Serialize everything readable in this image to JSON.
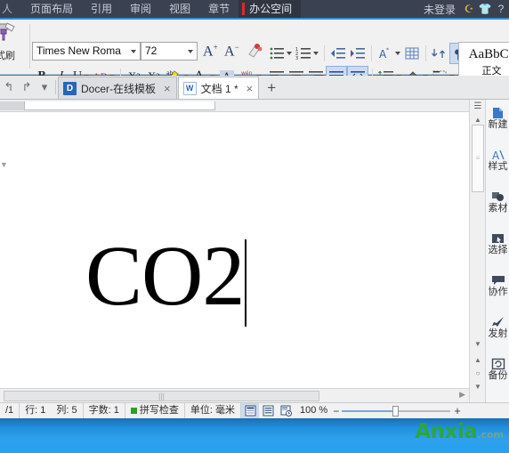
{
  "topbar": {
    "tabs": [
      {
        "label": "页面布局",
        "active": false
      },
      {
        "label": "引用",
        "active": false
      },
      {
        "label": "审阅",
        "active": false
      },
      {
        "label": "视图",
        "active": false
      },
      {
        "label": "章节",
        "active": false
      },
      {
        "label": "办公空间",
        "active": true
      }
    ],
    "account": "未登录",
    "icons": [
      "refresh-icon",
      "skin-icon",
      "help-icon"
    ],
    "accent_red": "#e02727",
    "bg": "#3a4150",
    "underline_color": "#2e8ed6"
  },
  "ribbon": {
    "clipboard": {
      "label": "式刷",
      "icon": "format-painter-icon"
    },
    "font_name": "Times New Roma",
    "font_size": "72",
    "grow_font": "A",
    "grow_font_sup": "+",
    "shrink_font": "A",
    "shrink_font_sup": "−",
    "clear_format": "clear-format-icon",
    "bold": "B",
    "italic": "I",
    "underline": "U",
    "strikethrough": "AB",
    "superscript_base": "X",
    "superscript_exp": "2",
    "subscript_base": "X",
    "subscript_exp": "2",
    "highlight": "ab",
    "font_color": "A",
    "char_shade": "A",
    "pinyin": "wén",
    "pinyin_sub": "文",
    "bullets": "bullet-list-icon",
    "numbering": "numbered-list-icon",
    "decrease_indent": "decrease-indent-icon",
    "increase_indent": "increase-indent-icon",
    "asian_layout": "asian-layout-icon",
    "borders_grid": "table-grid-icon",
    "sort": "sort-icon",
    "show_marks": "show-paragraph-marks-icon",
    "align_left": "align-left-icon",
    "align_center": "align-center-icon",
    "align_right": "align-right-icon",
    "align_justify": "align-justify-icon",
    "distribute": "distribute-icon",
    "line_spacing": "line-spacing-icon",
    "shading": "shading-icon",
    "borders": "borders-icon",
    "style_sample": "AaBbCc",
    "style_name": "正文"
  },
  "tabbar": {
    "undo": "undo-icon",
    "redo": "redo-icon",
    "more": "chevron-down-icon",
    "tabs": [
      {
        "label": "Docer-在线模板",
        "icon": "docer-icon",
        "active": false,
        "close": "×"
      },
      {
        "label": "文档 1 *",
        "icon": "document-icon",
        "active": true,
        "close": "×"
      }
    ],
    "new_tab": "+"
  },
  "document": {
    "text": "CO2",
    "cursor": "text-cursor"
  },
  "scrollbars": {
    "h_thumb_grip": "|||",
    "h_arrow": "▶",
    "v_split": "split-icon",
    "v_up": "▲",
    "v_page_up": "▼",
    "v_prev": "▲",
    "v_select": "○",
    "v_next": "▼"
  },
  "taskpane": {
    "items": [
      {
        "icon": "new-doc-icon",
        "label": "新建"
      },
      {
        "icon": "styles-icon",
        "label": "样式"
      },
      {
        "icon": "material-icon",
        "label": "素材"
      },
      {
        "icon": "selection-pane-icon",
        "label": "选择"
      },
      {
        "icon": "collaboration-icon",
        "label": "协作"
      },
      {
        "icon": "launch-icon",
        "label": "发射"
      },
      {
        "icon": "backup-icon",
        "label": "备份"
      }
    ]
  },
  "statusbar": {
    "page": "/1",
    "row": "行: 1",
    "column": "列: 5",
    "word_count": "字数: 1",
    "spellcheck": "拼写检查",
    "unit": "单位: 毫米",
    "view_page": "page-view-icon",
    "view_outline": "outline-view-icon",
    "view_web": "web-view-icon",
    "zoom": "100 %",
    "zoom_out": "−",
    "zoom_in": "+"
  },
  "desktop": {
    "watermark": "Anxia",
    "watermark_domain": ".com"
  }
}
